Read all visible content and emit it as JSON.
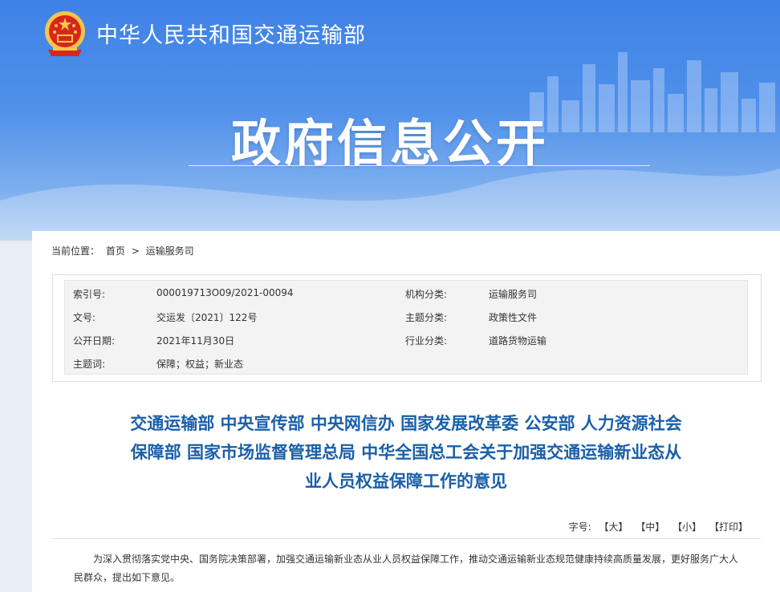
{
  "header": {
    "ministry_name": "中华人民共和国交通运输部",
    "banner_title": "政府信息公开"
  },
  "breadcrumb": {
    "prefix": "当前位置：",
    "home": "首页",
    "separator": ">",
    "current": "运输服务司"
  },
  "meta": {
    "index_label": "索引号:",
    "index_value": "000019713O09/2021-00094",
    "org_label": "机构分类:",
    "org_value": "运输服务司",
    "docno_label": "文号:",
    "docno_value": "交运发〔2021〕122号",
    "topic_label": "主题分类:",
    "topic_value": "政策性文件",
    "date_label": "公开日期:",
    "date_value": "2021年11月30日",
    "industry_label": "行业分类:",
    "industry_value": "道路货物运输",
    "keywords_label": "主题词:",
    "keywords_value": "保障；权益；新业态"
  },
  "document": {
    "title_line1": "交通运输部 中央宣传部 中央网信办 国家发展改革委 公安部 人力资源社会",
    "title_line2": "保障部 国家市场监督管理总局 中华全国总工会关于加强交通运输新业态从",
    "title_line3": "业人员权益保障工作的意见",
    "body": "为深入贯彻落实党中央、国务院决策部署，加强交通运输新业态从业人员权益保障工作，推动交通运输新业态规范健康持续高质量发展，更好服务广大人民群众，提出如下意见。"
  },
  "font_size": {
    "label": "字号:",
    "large": "【大】",
    "medium": "【中】",
    "small": "【小】",
    "print": "【打印】"
  },
  "colors": {
    "banner": "#3f82e6",
    "title": "#1a5fa8",
    "emblem_red": "#d7261e",
    "emblem_gold": "#f6c64a"
  }
}
